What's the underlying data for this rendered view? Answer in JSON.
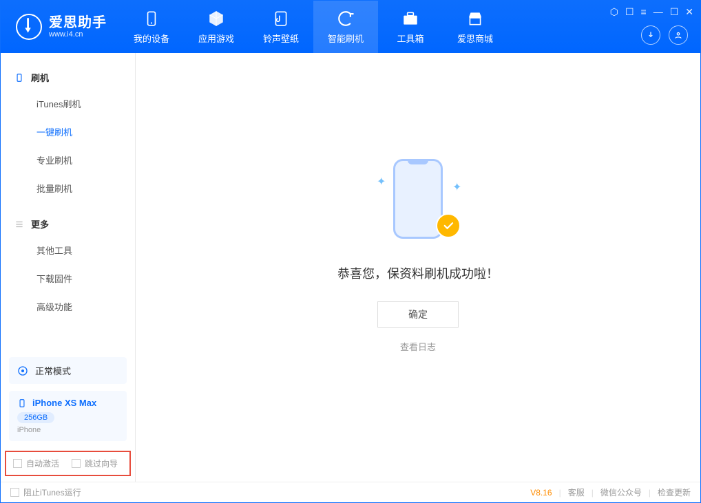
{
  "app": {
    "title": "爱思助手",
    "url": "www.i4.cn"
  },
  "nav": [
    {
      "label": "我的设备"
    },
    {
      "label": "应用游戏"
    },
    {
      "label": "铃声壁纸"
    },
    {
      "label": "智能刷机"
    },
    {
      "label": "工具箱"
    },
    {
      "label": "爱思商城"
    }
  ],
  "sidebar": {
    "group1_title": "刷机",
    "group1_items": [
      "iTunes刷机",
      "一键刷机",
      "专业刷机",
      "批量刷机"
    ],
    "group2_title": "更多",
    "group2_items": [
      "其他工具",
      "下载固件",
      "高级功能"
    ]
  },
  "device": {
    "status": "正常模式",
    "name": "iPhone XS Max",
    "capacity": "256GB",
    "type": "iPhone"
  },
  "checkbox1": "自动激活",
  "checkbox2": "跳过向导",
  "main": {
    "success": "恭喜您，保资料刷机成功啦！",
    "ok": "确定",
    "log": "查看日志"
  },
  "footer": {
    "block_itunes": "阻止iTunes运行",
    "version": "V8.16",
    "support": "客服",
    "wechat": "微信公众号",
    "update": "检查更新"
  }
}
